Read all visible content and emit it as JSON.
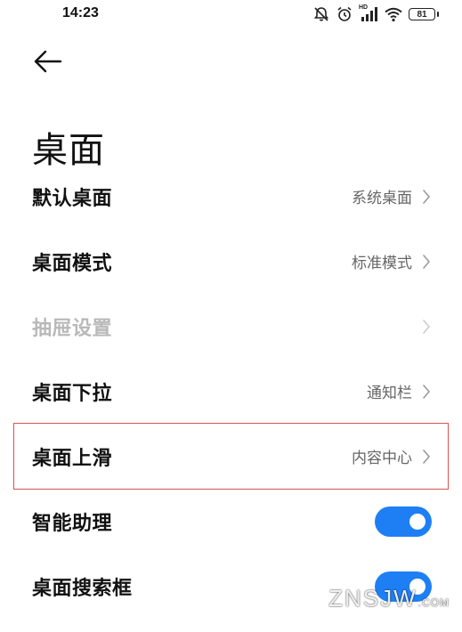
{
  "status_bar": {
    "time": "14:23",
    "battery_level": "81",
    "network_badge": "HD",
    "icons": [
      "bell-off-icon",
      "alarm-icon",
      "signal-icon",
      "wifi-icon",
      "battery-icon"
    ]
  },
  "header": {
    "back_icon": "back-arrow-icon",
    "title": "桌面"
  },
  "settings": {
    "items": [
      {
        "label": "默认桌面",
        "value": "系统桌面",
        "type": "link",
        "enabled": true
      },
      {
        "label": "桌面模式",
        "value": "标准模式",
        "type": "link",
        "enabled": true
      },
      {
        "label": "抽屉设置",
        "value": "",
        "type": "link",
        "enabled": false
      },
      {
        "label": "桌面下拉",
        "value": "通知栏",
        "type": "link",
        "enabled": true
      },
      {
        "label": "桌面上滑",
        "value": "内容中心",
        "type": "link",
        "enabled": true,
        "highlighted": true
      },
      {
        "label": "智能助理",
        "type": "toggle",
        "checked": true,
        "enabled": true
      },
      {
        "label": "桌面搜索框",
        "type": "toggle",
        "checked": true,
        "enabled": true
      }
    ]
  },
  "watermark": {
    "main": "ZNSJW",
    "suffix": ".COM"
  },
  "colors": {
    "toggle_on": "#1e7ff4",
    "highlight_border": "#d9534f",
    "disabled_text": "#b9b9b9",
    "value_text": "#666666"
  }
}
